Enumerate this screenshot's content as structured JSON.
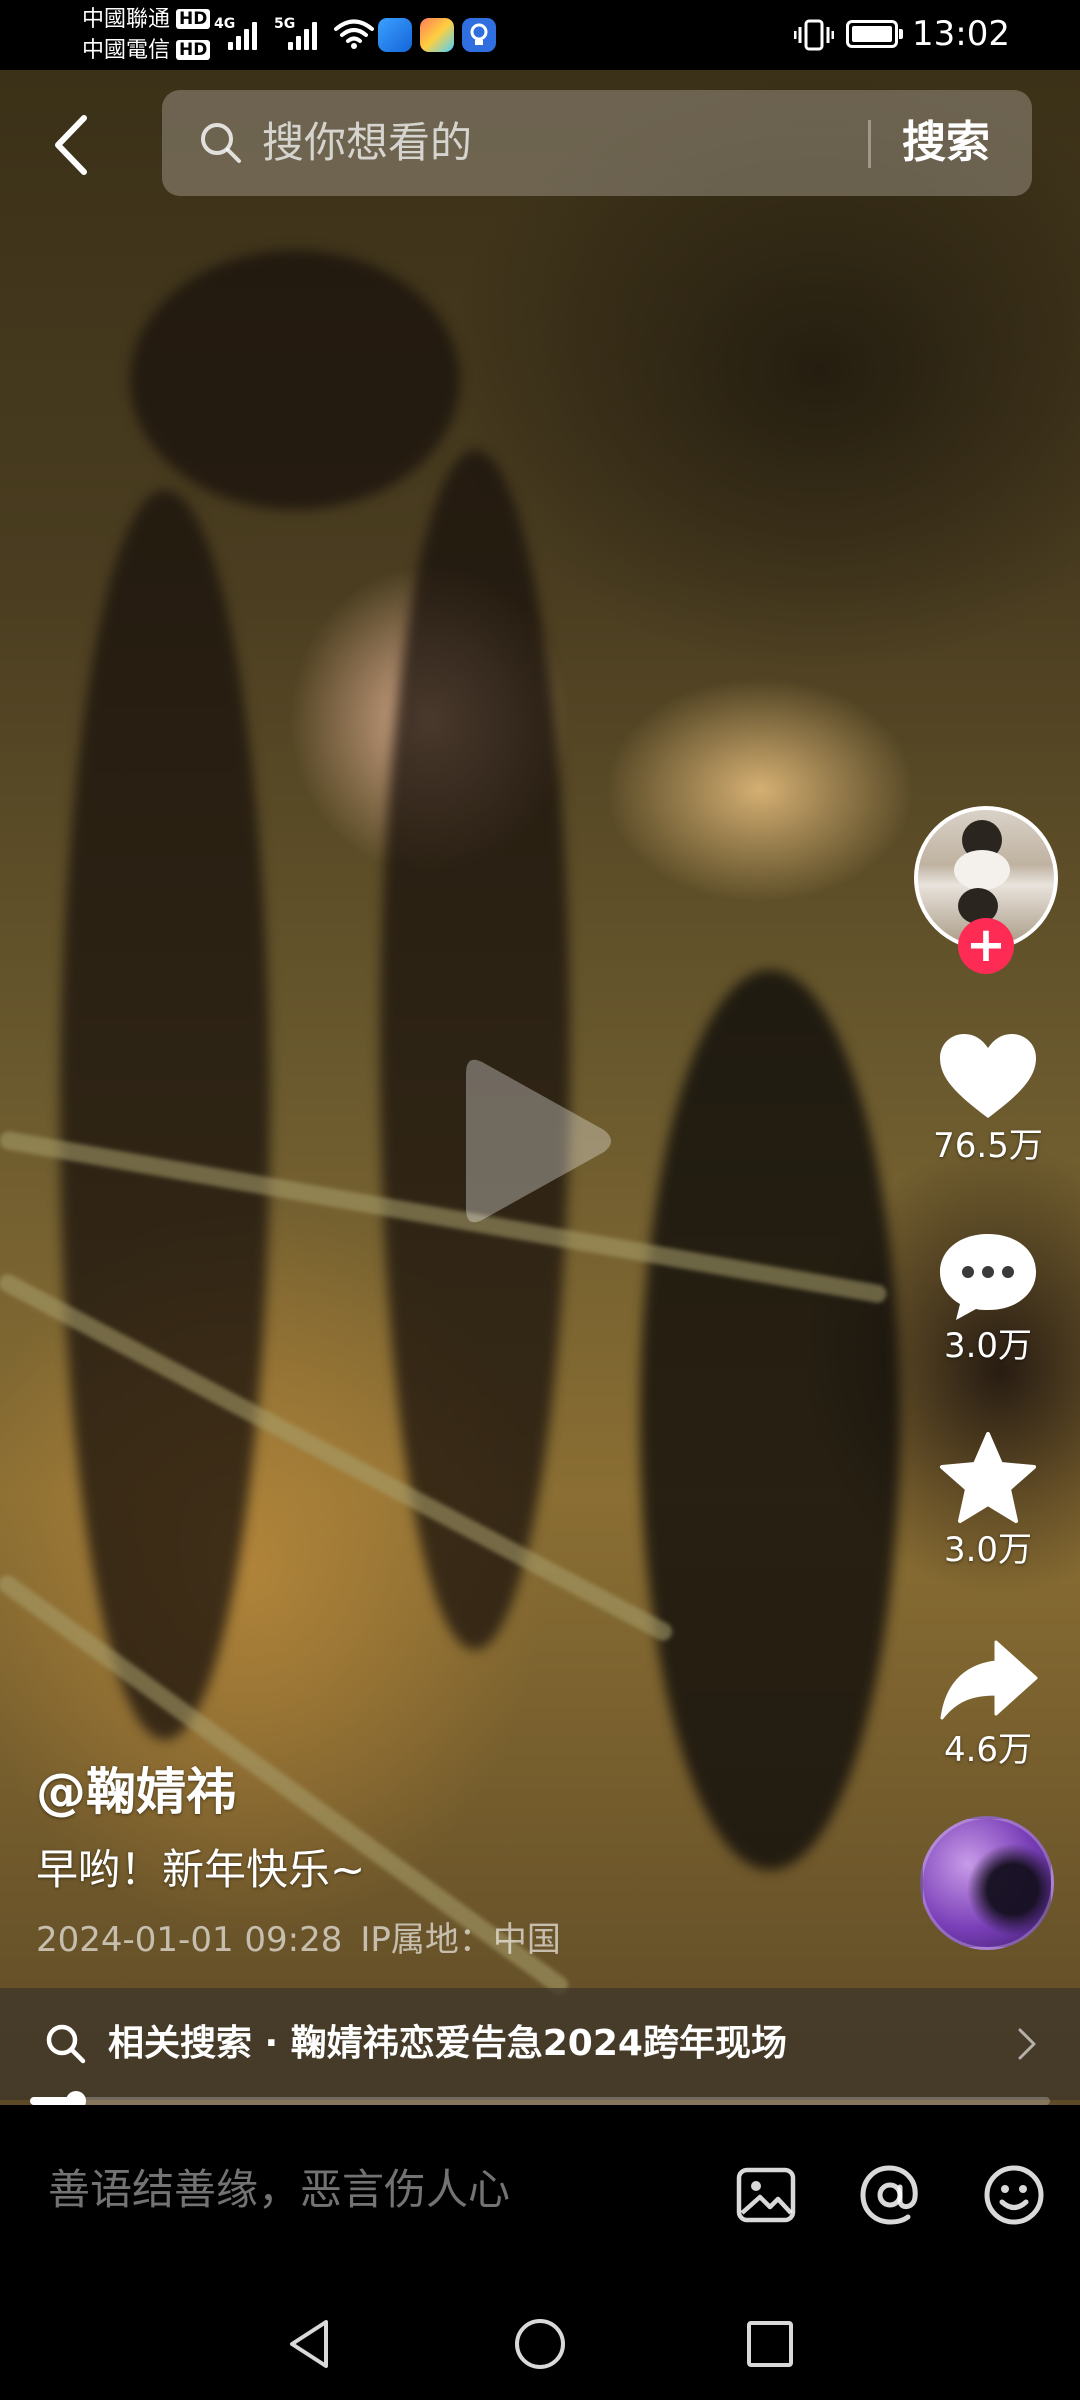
{
  "status_bar": {
    "carrier_1": "中國聯通",
    "carrier_2": "中國電信",
    "hd_label": "HD",
    "net_4g": "4G",
    "net_5g": "5G",
    "time": "13:02"
  },
  "search": {
    "placeholder": "搜你想看的",
    "button_label": "搜索"
  },
  "actions": {
    "likes": "76.5万",
    "comments": "3.0万",
    "favorites": "3.0万",
    "shares": "4.6万"
  },
  "post": {
    "author": "@鞠婧祎",
    "caption": "早哟！新年快乐~",
    "date": "2024-01-01 09:28",
    "ip_location": "IP属地：中国"
  },
  "related_search": {
    "text": "相关搜索 · 鞠婧祎恋爱告急2024跨年现场"
  },
  "playback": {
    "progress_percent": 4.5
  },
  "comment_bar": {
    "placeholder": "善语结善缘，恶言伤人心"
  },
  "icons": {
    "back": "back-icon",
    "search": "search-icon",
    "play": "play-icon",
    "like": "heart-icon",
    "comment": "comment-icon",
    "favorite": "star-icon",
    "share": "share-icon",
    "image": "image-icon",
    "mention": "at-icon",
    "emoji": "emoji-icon"
  },
  "colors": {
    "follow_accent": "#fe2c55"
  }
}
